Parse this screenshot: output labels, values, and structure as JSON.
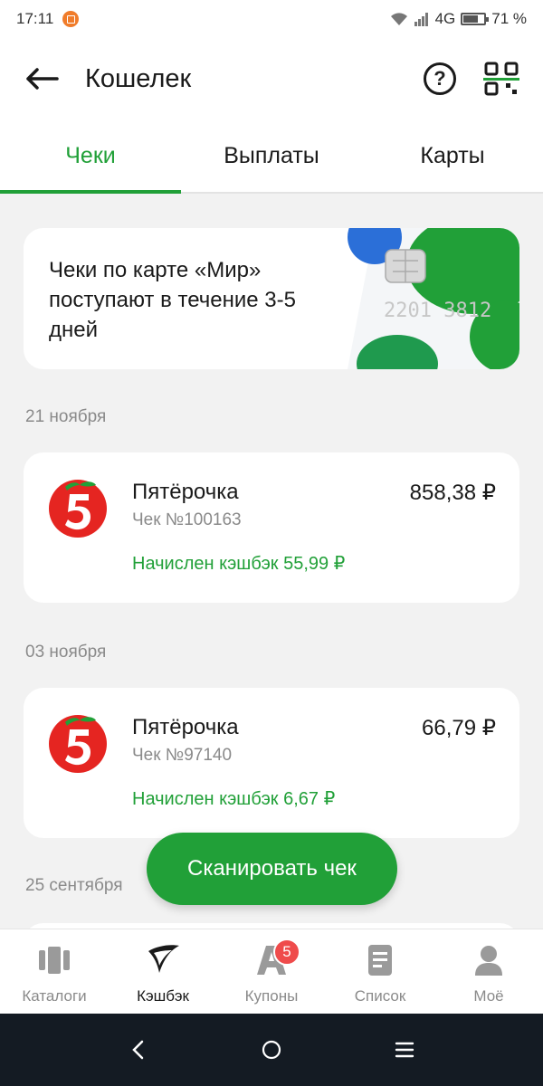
{
  "status_bar": {
    "time": "17:11",
    "network": "4G",
    "battery": "71 %",
    "battery_level": 0.71
  },
  "header": {
    "title": "Кошелек"
  },
  "tabs": [
    {
      "label": "Чеки",
      "active": true
    },
    {
      "label": "Выплаты",
      "active": false
    },
    {
      "label": "Карты",
      "active": false
    }
  ],
  "banner": {
    "text": "Чеки по карте «Мир» поступают в течение 3-5 дней",
    "card_numbers": "2201 3812"
  },
  "groups": [
    {
      "date": "21 ноября",
      "receipt": {
        "shop": "Пятёрочка",
        "amount": "858,38 ₽",
        "check": "Чек №100163",
        "cashback": "Начислен кэшбэк 55,99 ₽"
      }
    },
    {
      "date": "03 ноября",
      "receipt": {
        "shop": "Пятёрочка",
        "amount": "66,79 ₽",
        "check": "Чек №97140",
        "cashback": "Начислен кэшбэк 6,67 ₽"
      }
    },
    {
      "date": "25 сентября"
    }
  ],
  "scan_button": "Сканировать чек",
  "bottom_nav": [
    {
      "label": "Каталоги",
      "icon": "catalog-icon",
      "active": false
    },
    {
      "label": "Кэшбэк",
      "icon": "cashback-icon",
      "active": true
    },
    {
      "label": "Купоны",
      "icon": "coupons-icon",
      "active": false,
      "badge": "5"
    },
    {
      "label": "Список",
      "icon": "list-icon",
      "active": false
    },
    {
      "label": "Моё",
      "icon": "profile-icon",
      "active": false
    }
  ],
  "colors": {
    "accent": "#21a038",
    "badge": "#ef4b4b",
    "pyaterochka_red": "#e52521"
  }
}
